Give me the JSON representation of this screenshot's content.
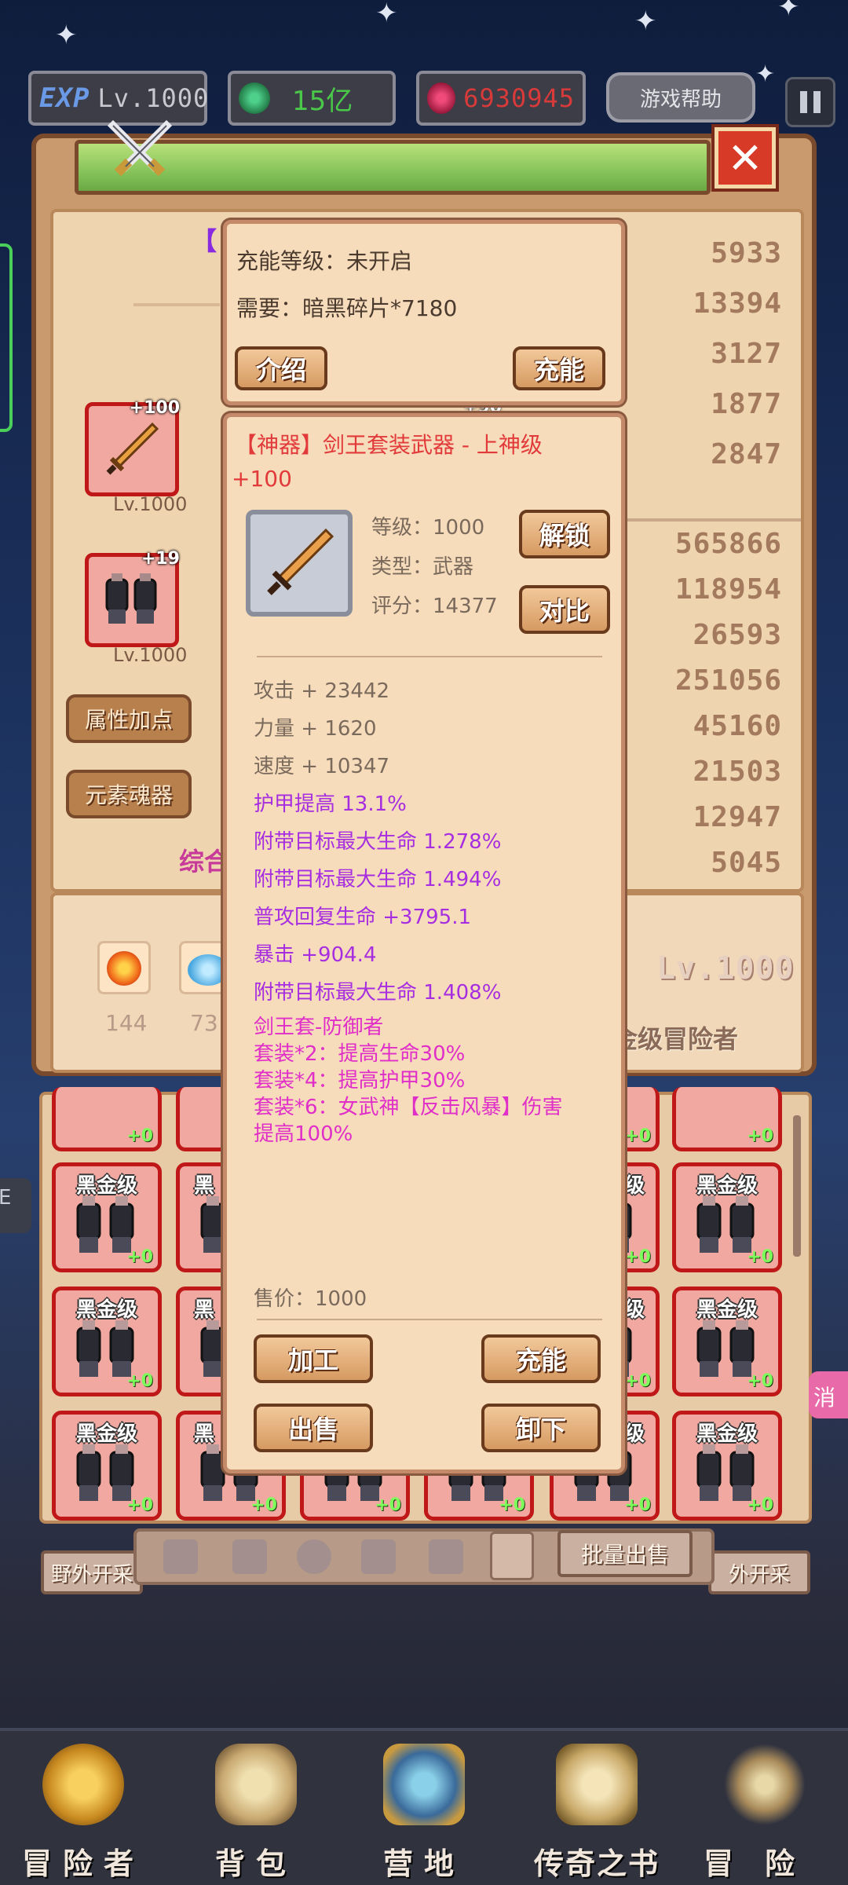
{
  "top_bar": {
    "exp_label": "EXP",
    "level": "Lv.1000",
    "green_gems": "15亿",
    "red_gems": "6930945",
    "help_button": "游戏帮助"
  },
  "character_panel": {
    "title_fragment": "【",
    "weapon_slot": {
      "plus": "+100",
      "level": "Lv.1000"
    },
    "gloves_slot": {
      "plus": "+19",
      "level": "Lv.1000"
    },
    "second_row_plus": "+90",
    "attr_button": "属性加点",
    "element_button": "元素魂器",
    "summary_fragment": "综合",
    "stat_values_top": [
      "5933",
      "13394",
      "3127",
      "1877",
      "2847"
    ],
    "stat_values_bottom": [
      "565866",
      "118954",
      "26593",
      "251056",
      "45160",
      "21503",
      "12947",
      "5045"
    ],
    "resources": [
      {
        "count": "144"
      },
      {
        "count": "73"
      }
    ],
    "player_level": "Lv.1000",
    "player_rank": "金级冒险者"
  },
  "charge_popup": {
    "charge_level": "充能等级：未开启",
    "requirement": "需要：暗黑碎片*7180",
    "intro_button": "介绍",
    "charge_button": "充能"
  },
  "item_popup": {
    "name_line1": "【神器】剑王套装武器 - 上神级",
    "name_line2": "+100",
    "level": "等级：1000",
    "type": "类型：武器",
    "score": "评分：14377",
    "unlock_button": "解锁",
    "compare_button": "对比",
    "base_stats": [
      "攻击 + 23442",
      "力量 + 1620",
      "速度 + 10347"
    ],
    "bonus_stats": [
      "护甲提高 13.1%",
      "附带目标最大生命 1.278%",
      "附带目标最大生命 1.494%",
      "普攻回复生命 +3795.1",
      "暴击 +904.4",
      "附带目标最大生命 1.408%"
    ],
    "set_name": "剑王套-防御者",
    "set_bonuses": [
      "套装*2：提高生命30%",
      "套装*4：提高护甲30%",
      "套装*6：女武神【反击风暴】伤害",
      "提高100%"
    ],
    "sell_price": "售价：1000",
    "process_button": "加工",
    "charge_button": "充能",
    "sell_button": "出售",
    "unequip_button": "卸下"
  },
  "inventory": {
    "grade_label": "黑金级",
    "plus_label": "+0",
    "partial_grade": "黑",
    "partial_grade_right": "级"
  },
  "side_labels": {
    "left_sign": "野外开采",
    "right_sign": "外开采",
    "right_tag": "消",
    "left_tag": "E"
  },
  "tab_bar": {
    "bulk_sell": "批量出售"
  },
  "nav": [
    {
      "label": "冒险者"
    },
    {
      "label": "背包"
    },
    {
      "label": "营地"
    },
    {
      "label": "传奇之书"
    },
    {
      "label": "冒险"
    }
  ]
}
